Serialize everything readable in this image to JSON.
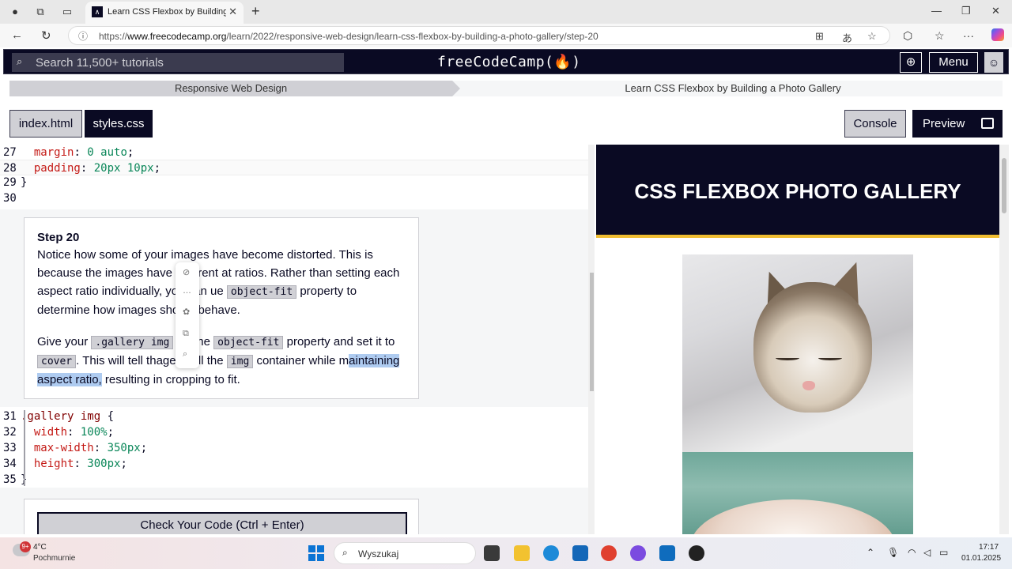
{
  "browser": {
    "tab_title": "Learn CSS Flexbox by Building a P",
    "url_prefix": "https://",
    "url_domain": "www.freecodecamp.org",
    "url_path": "/learn/2022/responsive-web-design/learn-css-flexbox-by-building-a-photo-gallery/step-20"
  },
  "fcc": {
    "search_placeholder": "Search 11,500+ tutorials",
    "logo": "freeCodeCamp(🔥)",
    "menu_label": "Menu"
  },
  "breadcrumb": {
    "superblock": "Responsive Web Design",
    "block": "Learn CSS Flexbox by Building a Photo Gallery"
  },
  "editor_tabs": {
    "html": "index.html",
    "css": "styles.css",
    "console": "Console",
    "preview": "Preview"
  },
  "code_top": [
    {
      "num": "27",
      "prop": "margin",
      "val": "0 auto"
    },
    {
      "num": "28",
      "prop": "padding",
      "val": "20px 10px"
    },
    {
      "num": "29",
      "text": "}"
    },
    {
      "num": "30",
      "text": ""
    }
  ],
  "step": {
    "title": "Step 20",
    "p1_a": "Notice how some of your images have become distorted. This is because the images have different a",
    "p1_b": "t ratios. Rather than setting each aspect ratio individually, you can u",
    "p1_c": "e",
    "p1_code": "object-fit",
    "p1_d": "property to determine how images should behave.",
    "p2_a": "Give your",
    "p2_code1": ".gallery img",
    "p2_b": "tor the",
    "p2_code2": "object-fit",
    "p2_c": "property and set it to",
    "p2_code3": "cover",
    "p2_d": ". This will tell th",
    "p2_e": "age to fill the",
    "p2_code4": "img",
    "p2_f": "container while m",
    "p2_sel": "aintaining aspect ratio,",
    "p2_g": " resulting in cropping to fit."
  },
  "code_bottom": [
    {
      "num": "31",
      "sel": ".gallery img",
      "text": " {"
    },
    {
      "num": "32",
      "prop": "width",
      "val": "100%"
    },
    {
      "num": "33",
      "prop": "max-width",
      "val": "350px"
    },
    {
      "num": "34",
      "prop": "height",
      "val": "300px"
    },
    {
      "num": "35",
      "text": "}"
    }
  ],
  "check_button": "Check Your Code (Ctrl + Enter)",
  "preview": {
    "title": "CSS FLEXBOX PHOTO GALLERY"
  },
  "taskbar": {
    "temp": "4°C",
    "weather": "Pochmurnie",
    "badge": "9+",
    "search": "Wyszukaj",
    "time": "17:17",
    "date": "01.01.2025"
  },
  "colors": {
    "fcc_dark": "#0a0a23",
    "accent_yellow": "#f1be32",
    "prop_red": "#c41a16",
    "val_green": "#098658"
  }
}
